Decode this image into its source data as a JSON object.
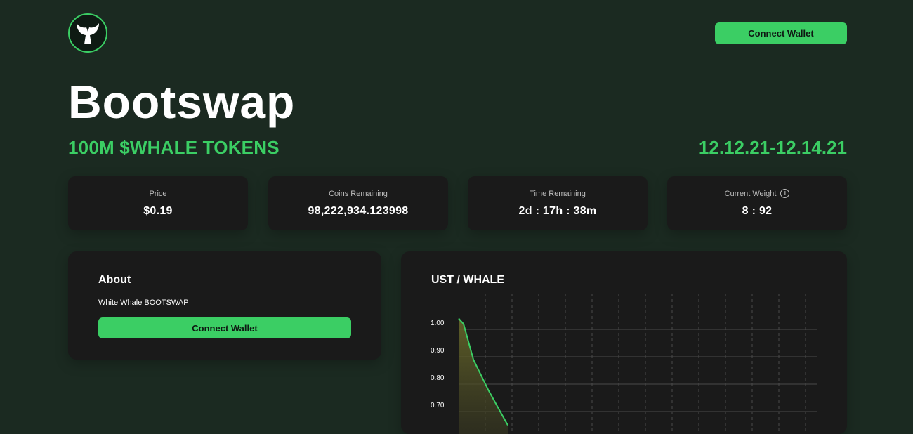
{
  "header": {
    "logo_icon": "whale-tail-icon",
    "connect_label": "Connect Wallet"
  },
  "hero": {
    "title": "Bootswap",
    "subtitle": "100M $WHALE TOKENS",
    "dates": "12.12.21-12.14.21"
  },
  "stats": [
    {
      "label": "Price",
      "value": "$0.19"
    },
    {
      "label": "Coins Remaining",
      "value": "98,222,934.123998"
    },
    {
      "label": "Time Remaining",
      "value": "2d : 17h : 38m"
    },
    {
      "label": "Current Weight",
      "value": "8 : 92",
      "icon": "info-icon",
      "icon_glyph": "i"
    }
  ],
  "about": {
    "title": "About",
    "text": "White Whale BOOTSWAP",
    "button_label": "Connect Wallet"
  },
  "chart_data": {
    "type": "area",
    "title": "UST / WHALE",
    "xlabel": "",
    "ylabel": "",
    "yticks": [
      "1.00",
      "0.90",
      "0.80",
      "0.70"
    ],
    "ylim": [
      0.65,
      1.05
    ],
    "x": [
      0,
      0.1,
      0.3,
      0.6,
      1.0
    ],
    "values": [
      1.04,
      1.02,
      0.89,
      0.78,
      0.65
    ],
    "grid": true,
    "colors": {
      "line": "#3bce64",
      "grid": "#4a4a4a"
    }
  },
  "colors": {
    "background": "#1b2a21",
    "accent": "#3bce64",
    "card": "#1a1a1a"
  }
}
